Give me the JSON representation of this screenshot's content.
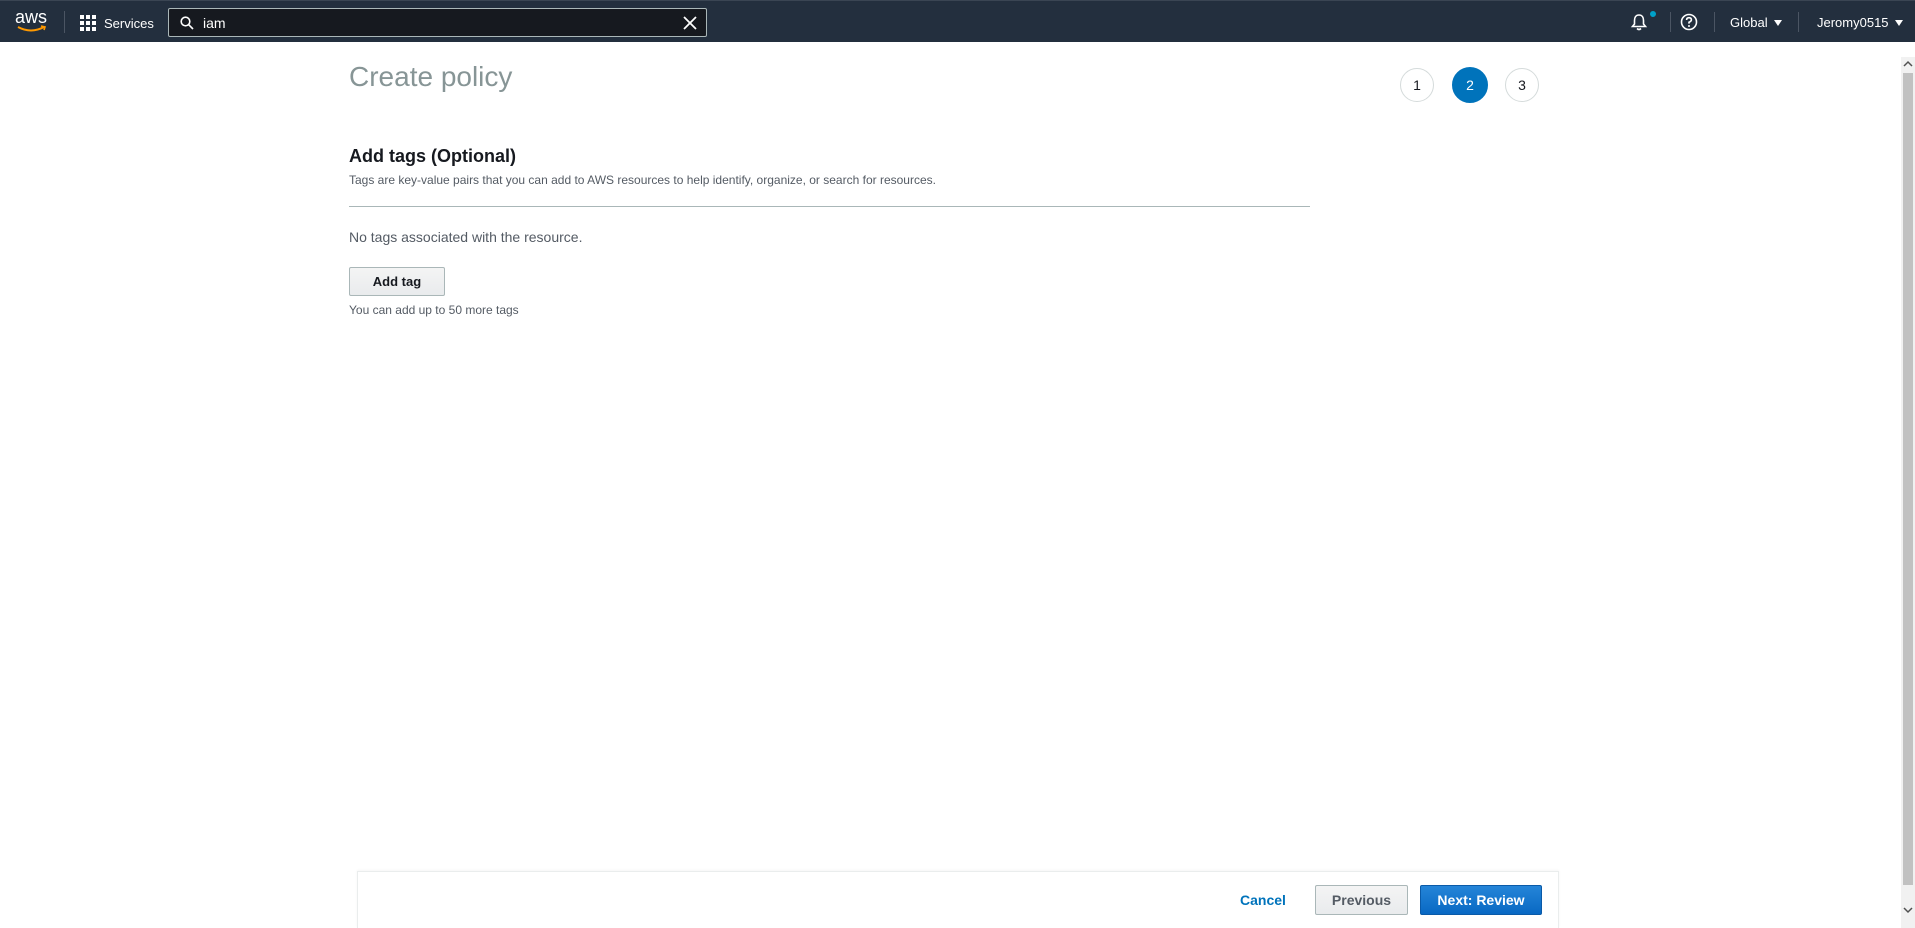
{
  "topbar": {
    "logo_text": "aws",
    "services_label": "Services",
    "search_value": "iam",
    "region_label": "Global",
    "account_label": "Jeromy0515",
    "icons": {
      "services": "grid-icon",
      "search": "search-icon",
      "clear": "close-icon",
      "notifications": "bell-icon",
      "help": "help-icon",
      "dropdown": "caret-down-icon"
    }
  },
  "page": {
    "title": "Create policy",
    "steps": [
      {
        "label": "1",
        "active": false
      },
      {
        "label": "2",
        "active": true
      },
      {
        "label": "3",
        "active": false
      }
    ]
  },
  "tags_section": {
    "title": "Add tags (Optional)",
    "description": "Tags are key-value pairs that you can add to AWS resources to help identify, organize, or search for resources.",
    "empty_text": "No tags associated with the resource.",
    "add_button_label": "Add tag",
    "hint": "You can add up to 50 more tags"
  },
  "footer": {
    "cancel_label": "Cancel",
    "previous_label": "Previous",
    "next_label": "Next: Review"
  },
  "colors": {
    "nav_background": "#232f3e",
    "primary": "#0073bb",
    "aws_orange": "#ff9900"
  }
}
